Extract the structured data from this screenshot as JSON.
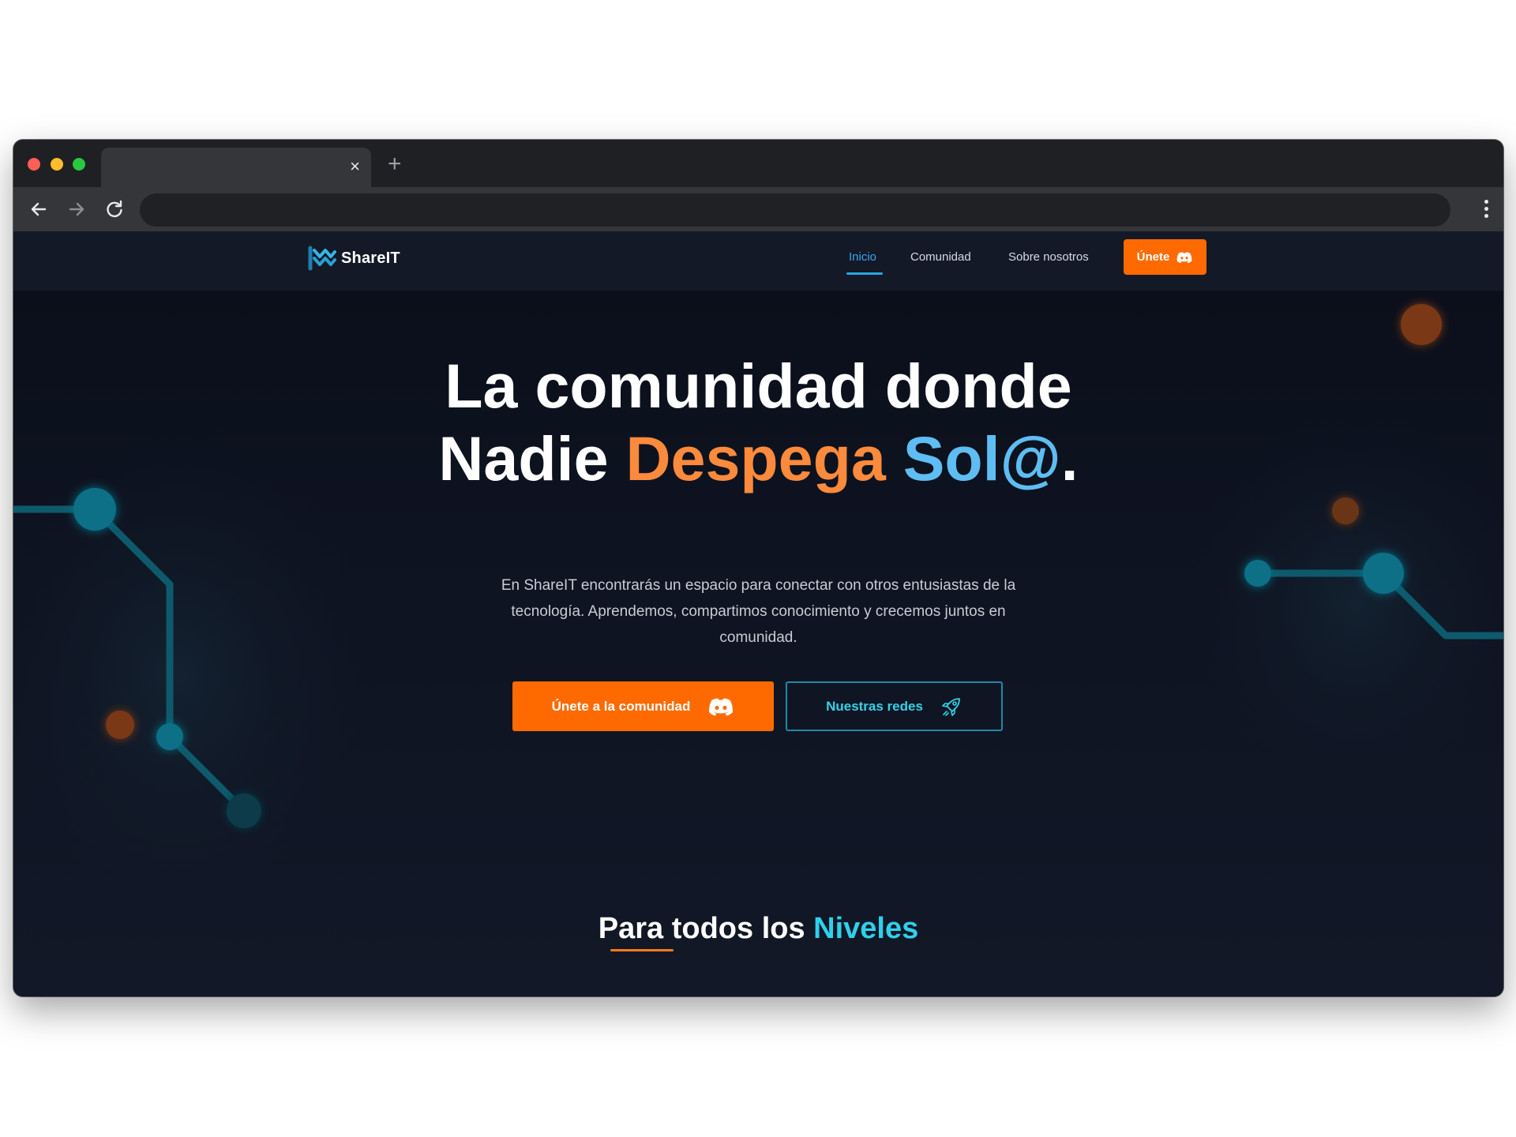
{
  "browser": {
    "tab_close": "×",
    "new_tab": "+"
  },
  "site": {
    "brand": "ShareIT",
    "nav": {
      "links": [
        "Inicio",
        "Comunidad",
        "Sobre nosotros"
      ],
      "active": "Inicio",
      "cta_label": "Únete"
    },
    "hero": {
      "title_line1": "La comunidad donde",
      "title_line2_a": "Nadie ",
      "title_line2_b": "Despega",
      "title_line2_c": "Sol@",
      "title_line2_d": ".",
      "description": "En ShareIT encontrarás un espacio para conectar con otros entusiastas de la tecnología. Aprendemos, compartimos conocimiento y crecemos juntos en comunidad.",
      "primary_button": "Únete a la comunidad",
      "secondary_button": "Nuestras redes"
    },
    "section": {
      "title_a": "Para todos los ",
      "title_b": "Niveles"
    }
  },
  "colors": {
    "accent_orange": "#ff6a00",
    "accent_blue": "#5ebdf2",
    "accent_cyan": "#2fd0ea",
    "page_bg": "#0e1321"
  },
  "icons": [
    "back-arrow-icon",
    "forward-arrow-icon",
    "reload-icon",
    "menu-dots-icon",
    "discord-icon",
    "rocket-icon",
    "shareit-logo-icon"
  ]
}
